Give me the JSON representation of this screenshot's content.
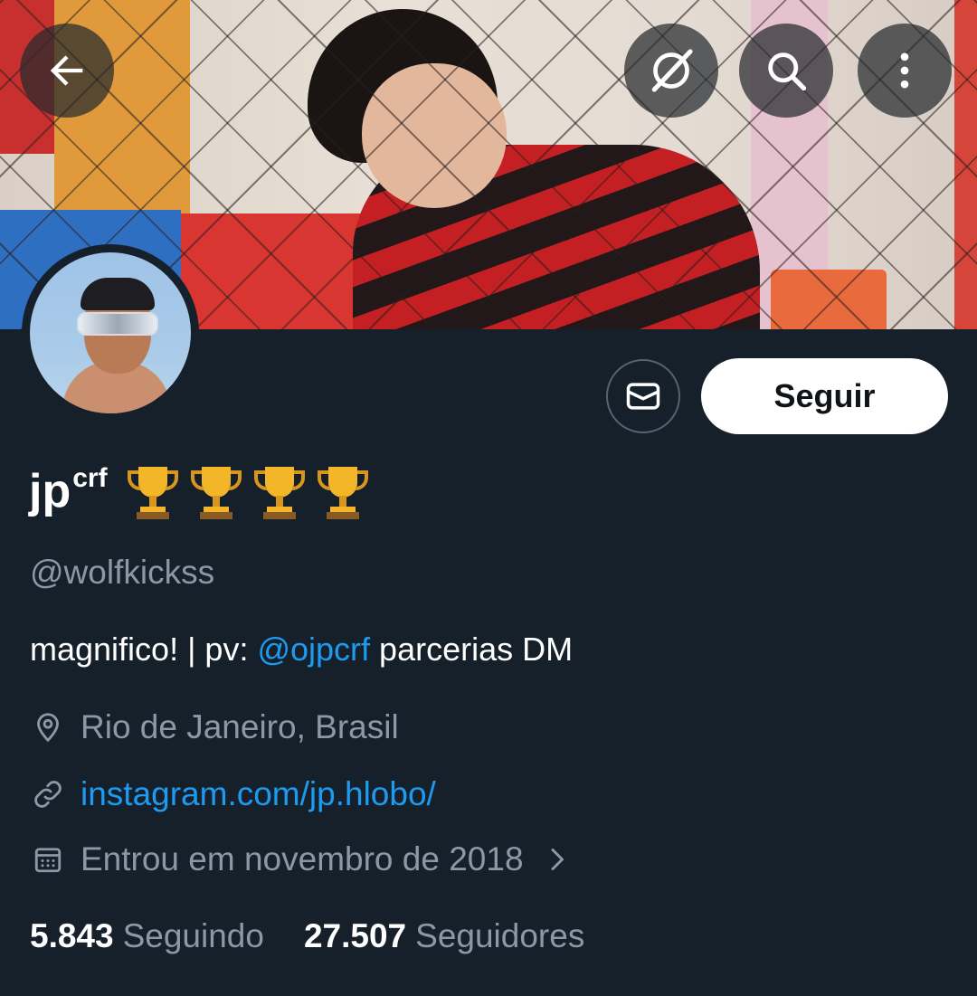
{
  "header": {
    "back_icon": "arrow-left-icon",
    "actions": [
      "no-grok-icon",
      "search-icon",
      "more-vertical-icon"
    ]
  },
  "profile": {
    "display_name": "jp",
    "display_name_sup": "crf",
    "name_emoji": "🏆🏆🏆🏆",
    "handle": "@wolfkickss",
    "bio": {
      "prefix": "magnifico! | pv: ",
      "mention": "@ojpcrf",
      "suffix": " parcerias DM"
    },
    "location": "Rio de Janeiro, Brasil",
    "website": "instagram.com/jp.hlobo/",
    "joined": "Entrou em novembro de 2018",
    "following_count": "5.843",
    "following_label": "Seguindo",
    "followers_count": "27.507",
    "followers_label": "Seguidores"
  },
  "actions": {
    "follow_label": "Seguir",
    "message_icon": "envelope-icon"
  },
  "colors": {
    "background": "#15202b",
    "accent": "#1d9bf0",
    "secondary_text": "#8b98a5"
  }
}
